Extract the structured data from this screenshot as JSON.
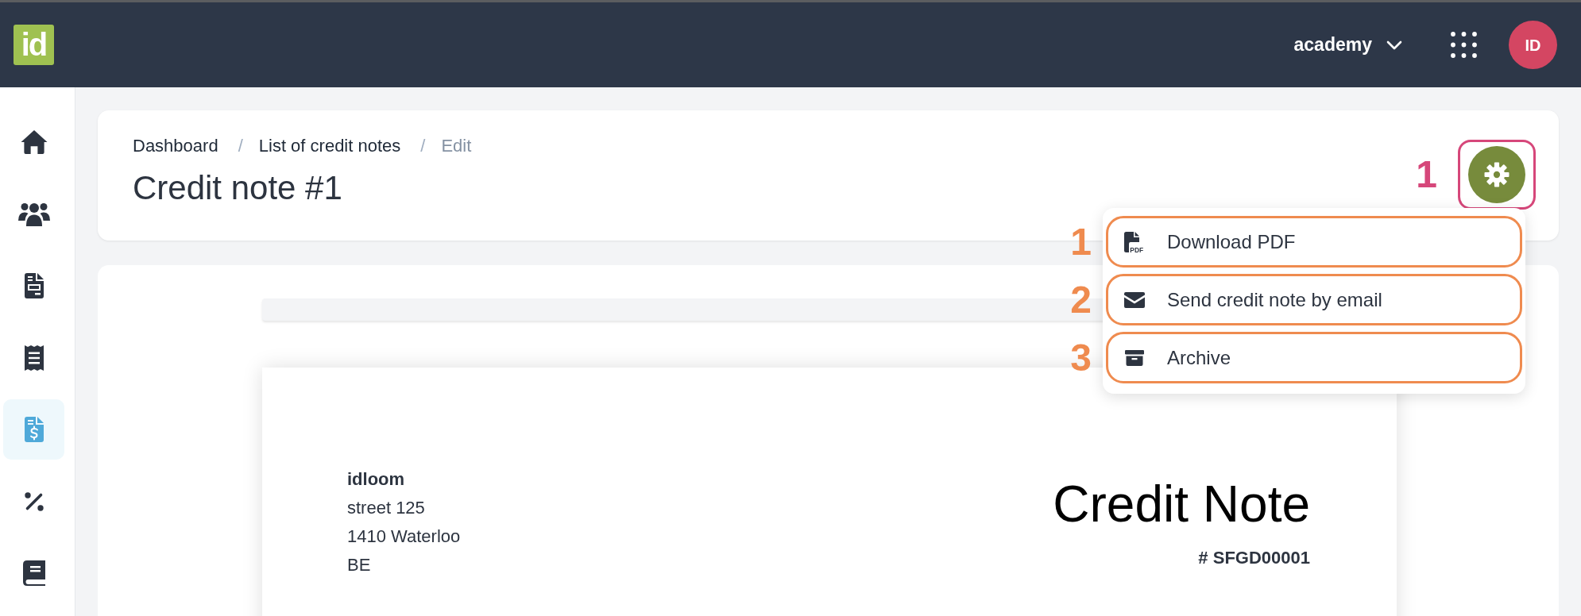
{
  "top_bar": {
    "logo": "id",
    "account": "academy",
    "avatar": "ID"
  },
  "sidebar": {
    "items": [
      {
        "selected": false
      },
      {
        "selected": false
      },
      {
        "selected": false
      },
      {
        "selected": false
      },
      {
        "selected": true
      },
      {
        "selected": false
      },
      {
        "selected": false
      }
    ]
  },
  "header": {
    "breadcrumb": {
      "separator": "/",
      "items": [
        {
          "label": "Dashboard",
          "current": false
        },
        {
          "label": "List of credit notes",
          "current": false
        },
        {
          "label": "Edit",
          "current": true
        }
      ]
    },
    "title": "Credit note #1",
    "settings_button": {
      "callout": "1",
      "highlighted": true
    }
  },
  "actions_menu": {
    "open": true,
    "items": [
      {
        "label": "Download PDF",
        "icon_text": "PDF",
        "callout": "1",
        "highlighted": true
      },
      {
        "label": "Send credit note by email",
        "callout": "2",
        "highlighted": true
      },
      {
        "label": "Archive",
        "callout": "3",
        "highlighted": true
      }
    ]
  },
  "document": {
    "sender": {
      "name": "idloom",
      "address_lines": [
        "street 125",
        "1410 Waterloo",
        "BE"
      ]
    },
    "title": "Credit Note",
    "number": "# SFGD00001"
  }
}
